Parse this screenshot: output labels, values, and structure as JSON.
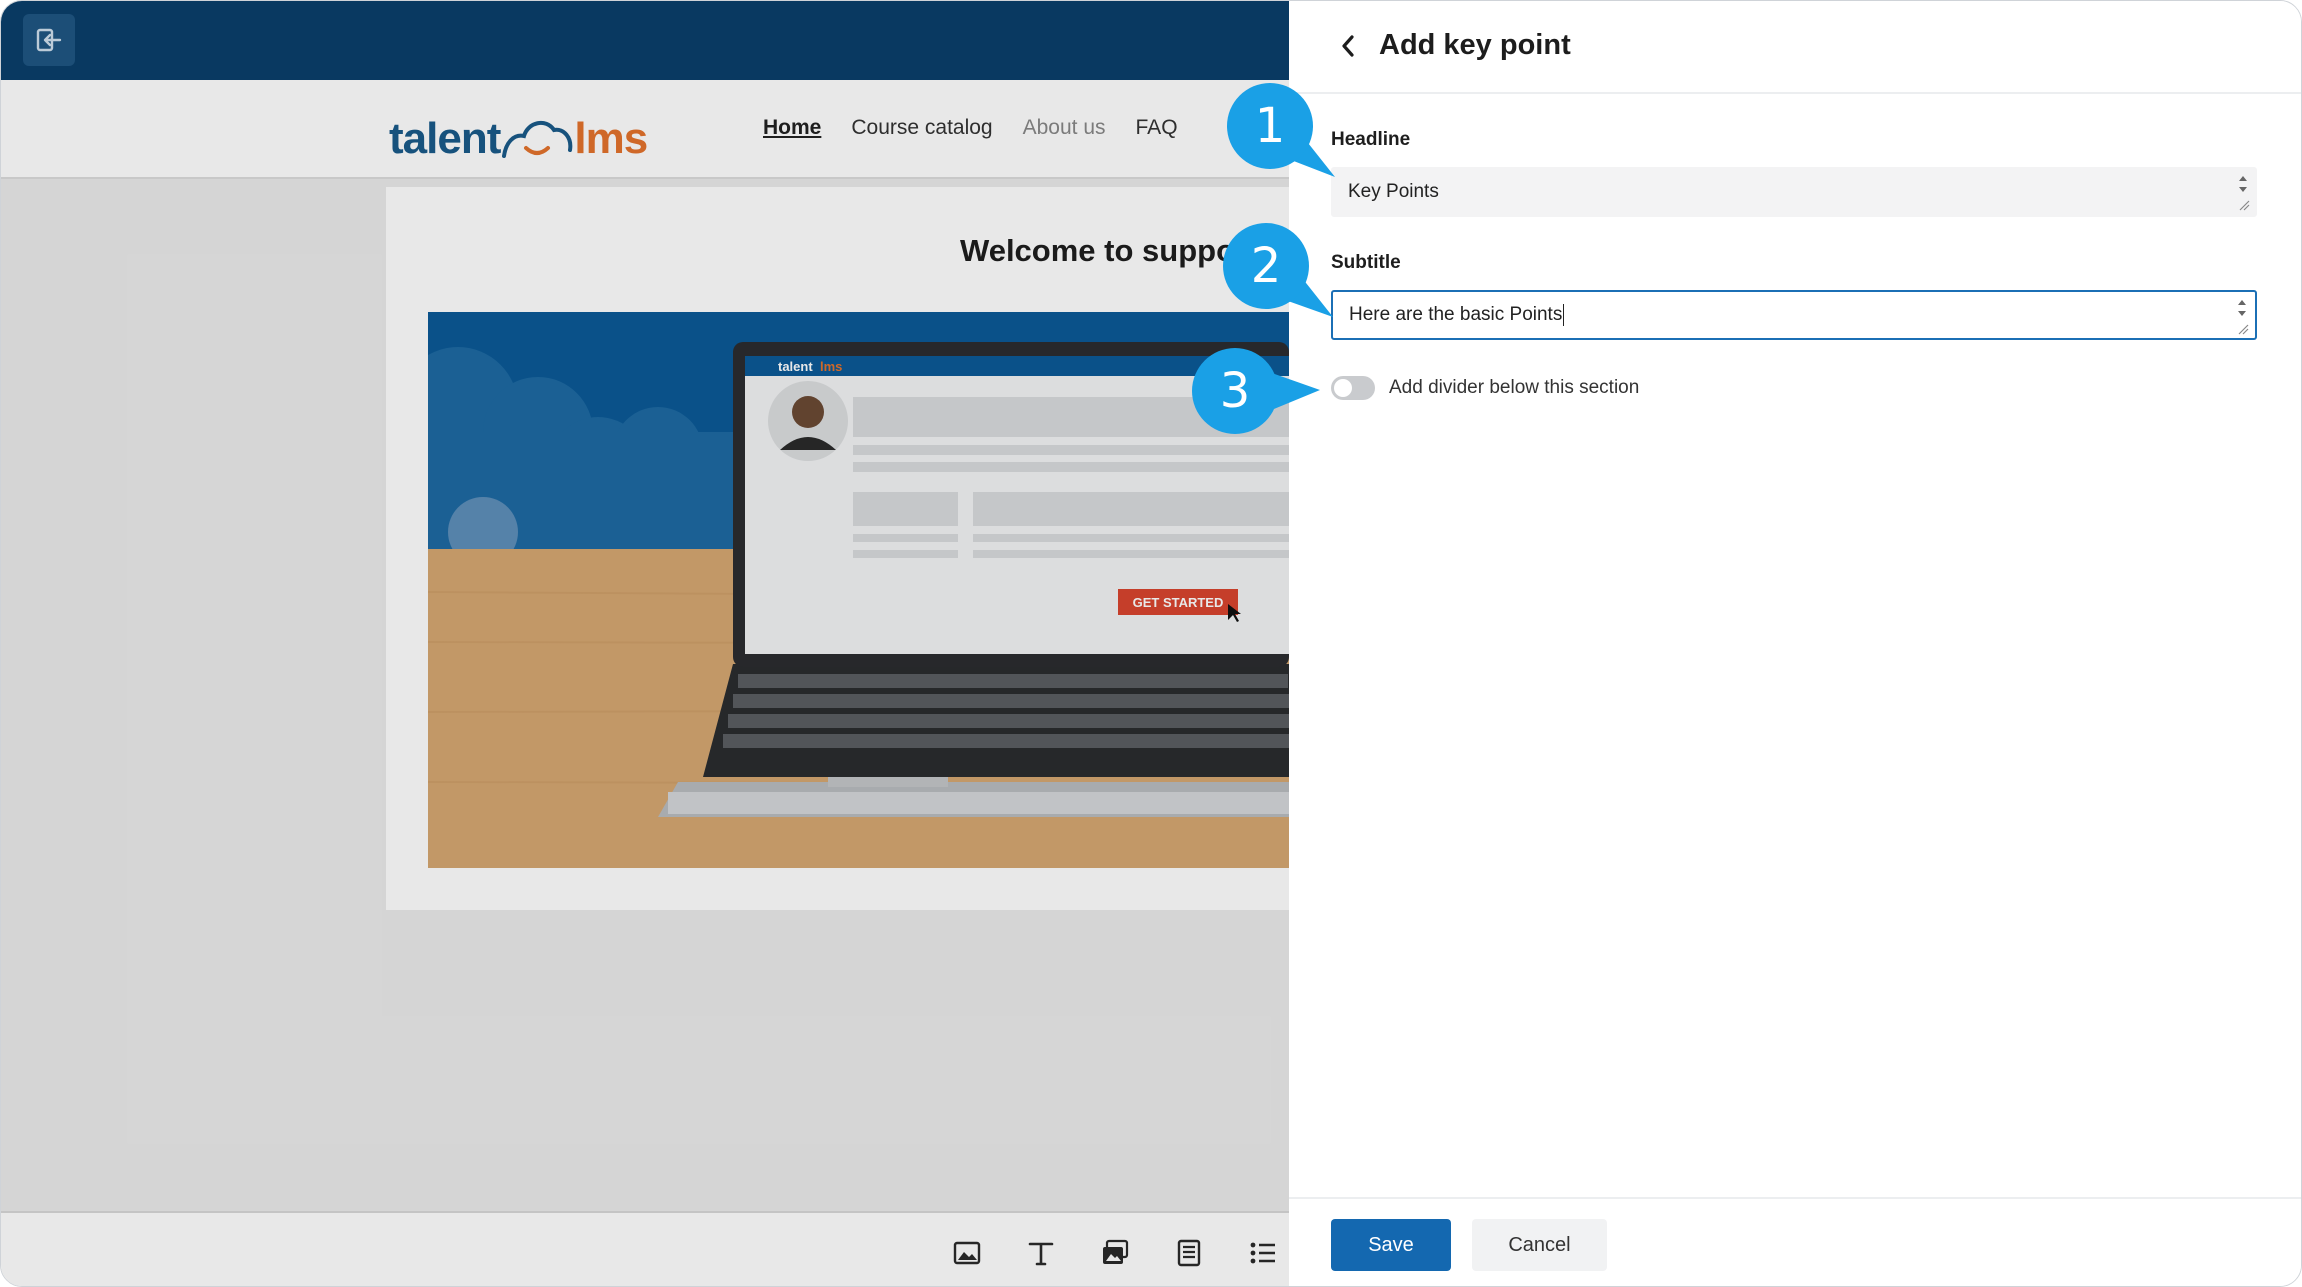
{
  "editor": {
    "site": {
      "logo_left": "talent",
      "logo_right": "lms",
      "nav": [
        {
          "label": "Home",
          "state": "active"
        },
        {
          "label": "Course catalog",
          "state": "normal"
        },
        {
          "label": "About us",
          "state": "muted"
        },
        {
          "label": "FAQ",
          "state": "normal"
        }
      ],
      "welcome_text": "Welcome to suppor"
    },
    "hero": {
      "laptop_logo_left": "talent",
      "laptop_logo_right": "lms",
      "cta_label": "GET STARTED"
    },
    "toolbar_icons": [
      "image-block-icon",
      "text-block-icon",
      "gallery-block-icon",
      "document-block-icon",
      "list-block-icon"
    ]
  },
  "panel": {
    "title": "Add key point",
    "headline": {
      "label": "Headline",
      "value": "Key Points"
    },
    "subtitle": {
      "label": "Subtitle",
      "value": "Here are the basic Points"
    },
    "divider_toggle": {
      "label": "Add divider below this section",
      "on": false
    },
    "save_label": "Save",
    "cancel_label": "Cancel"
  },
  "callouts": [
    "1",
    "2",
    "3"
  ],
  "colors": {
    "topbar": "#0a3f6b",
    "primary": "#1468b0",
    "callout": "#1aa0e6",
    "logo_blue": "#1a5b8a",
    "logo_orange": "#e4732d",
    "cta_red": "#d9452f"
  }
}
